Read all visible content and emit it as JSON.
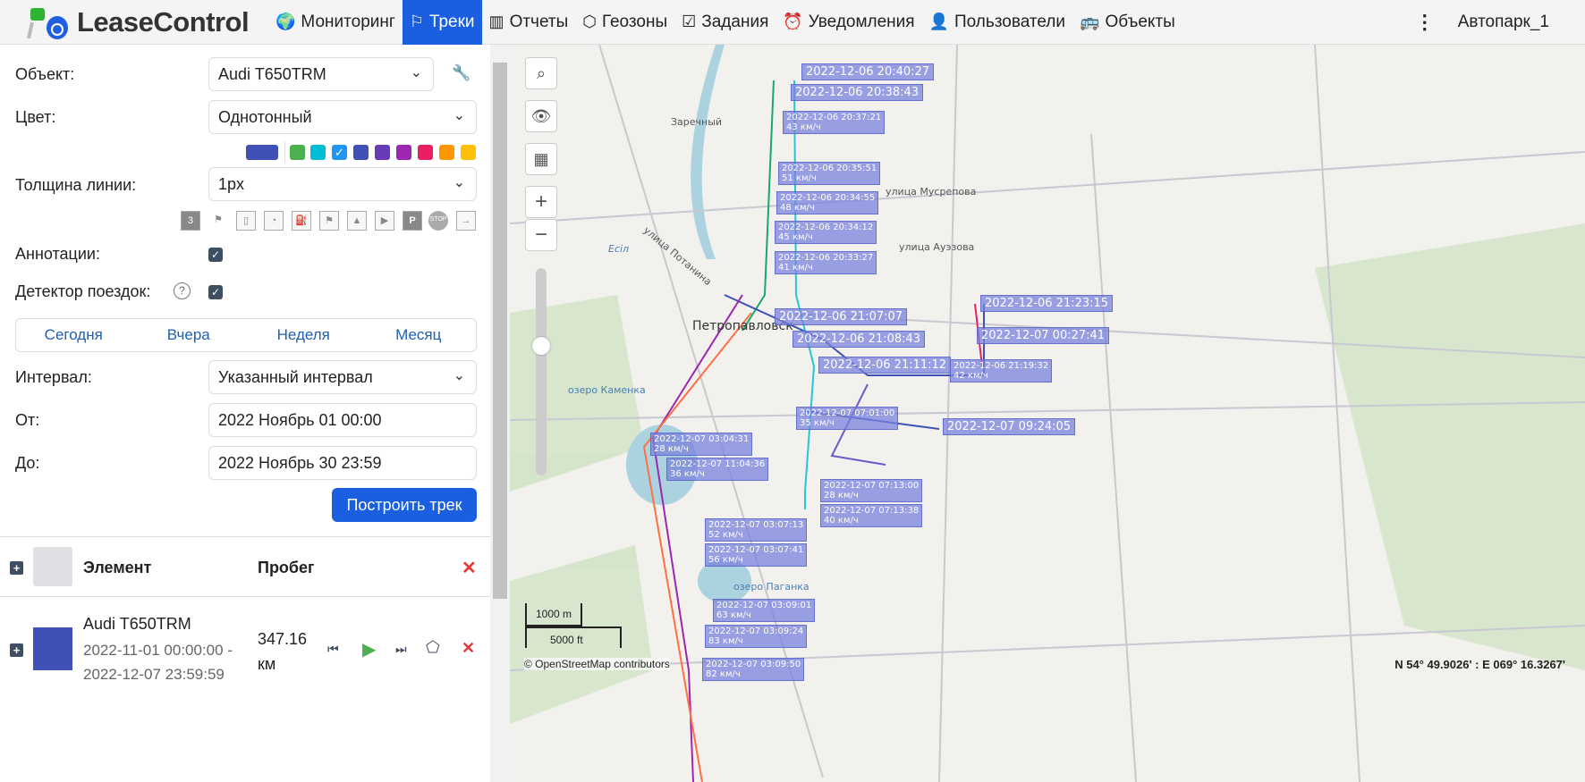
{
  "header": {
    "logo": "LeaseControl",
    "nav": [
      {
        "label": "Мониторинг",
        "icon": "globe-icon"
      },
      {
        "label": "Треки",
        "icon": "flag-icon",
        "active": true
      },
      {
        "label": "Отчеты",
        "icon": "chart-icon"
      },
      {
        "label": "Геозоны",
        "icon": "polygon-icon"
      },
      {
        "label": "Задания",
        "icon": "clipboard-icon"
      },
      {
        "label": "Уведомления",
        "icon": "alarm-icon"
      },
      {
        "label": "Пользователи",
        "icon": "user-icon"
      },
      {
        "label": "Объекты",
        "icon": "bus-icon"
      }
    ],
    "account": "Автопарк_1"
  },
  "form": {
    "object_label": "Объект:",
    "object_value": "Audi T650TRM",
    "color_label": "Цвет:",
    "color_value": "Однотонный",
    "colors": [
      "#3f51b5",
      "#4caf50",
      "#00bcd4",
      "#2196f3",
      "#3f51b5",
      "#673ab7",
      "#9c27b0",
      "#e91e63",
      "#ff9800",
      "#ffc107"
    ],
    "width_label": "Толщина линии:",
    "width_value": "1px",
    "annotations_label": "Аннотации:",
    "trip_label": "Детектор поездок:",
    "periods": [
      "Сегодня",
      "Вчера",
      "Неделя",
      "Месяц"
    ],
    "interval_label": "Интервал:",
    "interval_value": "Указанный интервал",
    "from_label": "От:",
    "from_value": "2022 Ноябрь 01 00:00",
    "to_label": "До:",
    "to_value": "2022 Ноябрь 30 23:59",
    "build": "Построить трек",
    "tool_icons": [
      "3",
      "P",
      "STOP"
    ]
  },
  "table": {
    "col_element": "Элемент",
    "col_mileage": "Пробег",
    "rows": [
      {
        "name": "Audi T650TRM",
        "from": "2022-11-01 00:00:00 -",
        "to": "2022-12-07 23:59:59",
        "mileage": "347.16",
        "unit": "км",
        "color": "#3f51b5"
      }
    ]
  },
  "map": {
    "labels": [
      "2022-12-06 20:40:27",
      "2022-12-06 20:38:43",
      "2022-12-06 20:37:21\n43 км/ч",
      "2022-12-06 20:35:51\n51 км/ч",
      "2022-12-06 20:34:55\n48 км/ч",
      "2022-12-06 20:34:12\n45 км/ч",
      "2022-12-06 20:33:27\n41 км/ч",
      "2022-12-06 21:07:07",
      "2022-12-06 21:08:43",
      "2022-12-06 21:11:12",
      "2022-12-06 21:23:15",
      "2022-12-07 00:27:41",
      "2022-12-06 21:19:32\n42 км/ч",
      "2022-12-07 07:01:00\n35 км/ч",
      "2022-12-07 09:24:05",
      "2022-12-07 03:04:31\n28 км/ч",
      "2022-12-07 11:04:36\n36 км/ч",
      "2022-12-07 07:13:00\n28 км/ч",
      "2022-12-07 07:13:38\n40 км/ч",
      "2022-12-07 03:07:13\n52 км/ч",
      "2022-12-07 03:07:41\n56 км/ч",
      "2022-12-07 03:09:01\n63 км/ч",
      "2022-12-07 03:09:24\n83 км/ч",
      "2022-12-07 03:09:50\n82 км/ч"
    ],
    "places": [
      "Заречный",
      "Петропавловск",
      "улица Мусрепова",
      "улица Ауэзова",
      "улица Потанина",
      "озеро Каменка",
      "озеро Паганка",
      "Есіл"
    ],
    "scale_m": "1000 m",
    "scale_ft": "5000 ft",
    "attribution": "© OpenStreetMap contributors",
    "coords": "N 54° 49.9026' : E 069° 16.3267'"
  }
}
